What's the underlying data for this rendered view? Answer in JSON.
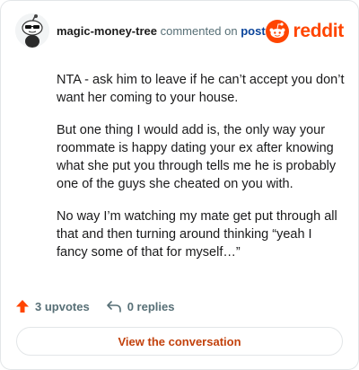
{
  "header": {
    "username": "magic-money-tree",
    "action_text": "commented on",
    "post_link": "post",
    "brand": "reddit",
    "brand_color": "#ff4500"
  },
  "comment": {
    "paragraphs": [
      "NTA - ask him to leave if he can’t accept you don’t want her coming to your house.",
      "But one thing I would add is, the only way your roommate is happy dating your ex after knowing what she put you through tells me he is probably one of the guys she cheated on you with.",
      "No way I’m watching my mate get put through all that and then turning around thinking “yeah I fancy some of that for myself…”"
    ]
  },
  "footer": {
    "upvotes": "3 upvotes",
    "replies": "0 replies",
    "upvote_icon": "upvote-arrow-icon",
    "reply_icon": "reply-arrow-icon"
  },
  "cta": {
    "label": "View the conversation"
  }
}
